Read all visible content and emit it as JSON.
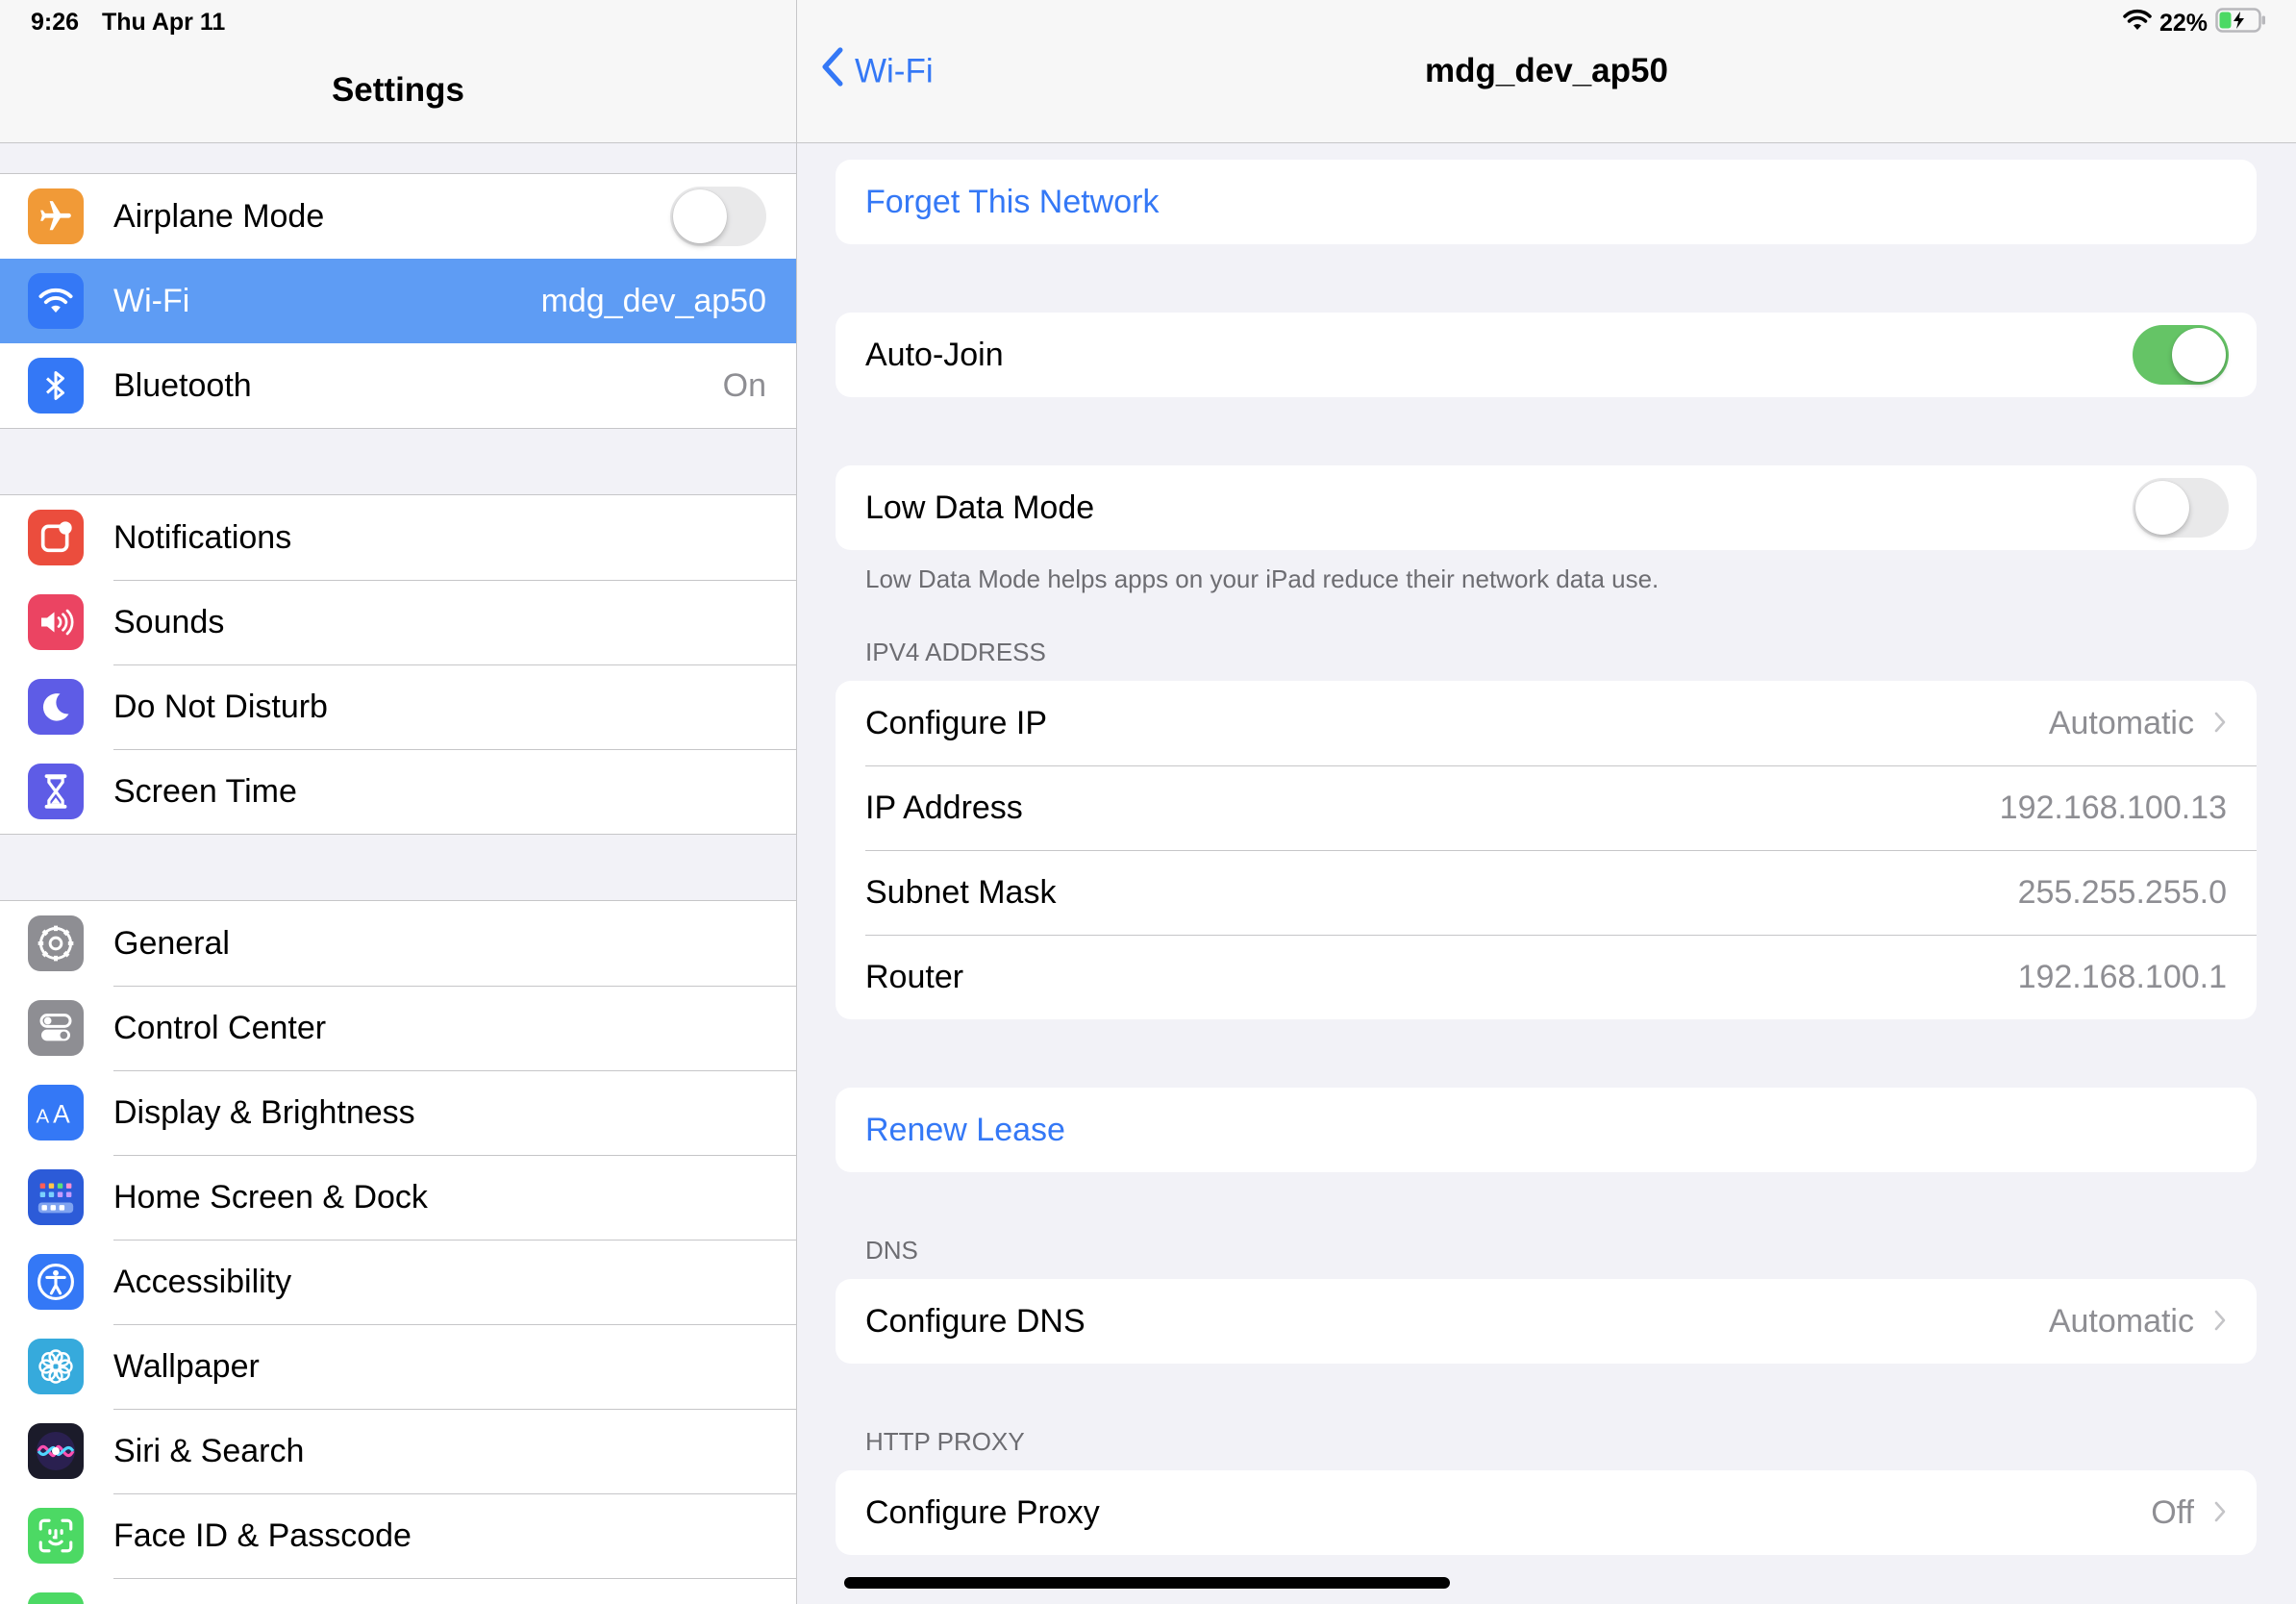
{
  "status_bar": {
    "time": "9:26",
    "date": "Thu Apr 11",
    "battery": "22%"
  },
  "sidebar": {
    "title": "Settings",
    "groups": [
      [
        {
          "label": "Airplane Mode",
          "icon": "airplane-icon",
          "color": "#f19a37",
          "toggle": false
        },
        {
          "label": "Wi-Fi",
          "icon": "wifi-icon",
          "color": "#3478f6",
          "value": "mdg_dev_ap50",
          "selected": true
        },
        {
          "label": "Bluetooth",
          "icon": "bluetooth-icon",
          "color": "#3478f6",
          "value": "On"
        }
      ],
      [
        {
          "label": "Notifications",
          "icon": "notifications-icon",
          "color": "#eb4d3d"
        },
        {
          "label": "Sounds",
          "icon": "speaker-icon",
          "color": "#eb4462"
        },
        {
          "label": "Do Not Disturb",
          "icon": "moon-icon",
          "color": "#5e5ce6"
        },
        {
          "label": "Screen Time",
          "icon": "hourglass-icon",
          "color": "#5e5ce6"
        }
      ],
      [
        {
          "label": "General",
          "icon": "gear-icon",
          "color": "#8e8e93"
        },
        {
          "label": "Control Center",
          "icon": "control-center-icon",
          "color": "#8e8e93"
        },
        {
          "label": "Display & Brightness",
          "icon": "display-aa-icon",
          "color": "#3478f6"
        },
        {
          "label": "Home Screen & Dock",
          "icon": "home-screen-grid-icon",
          "color": "#2c5bd8"
        },
        {
          "label": "Accessibility",
          "icon": "accessibility-icon",
          "color": "#3478f6"
        },
        {
          "label": "Wallpaper",
          "icon": "wallpaper-flower-icon",
          "color": "#36aadc"
        },
        {
          "label": "Siri & Search",
          "icon": "siri-icon",
          "color": "#222222"
        },
        {
          "label": "Face ID & Passcode",
          "icon": "face-id-icon",
          "color": "#4cd964"
        }
      ]
    ]
  },
  "detail": {
    "back_label": "Wi-Fi",
    "title": "mdg_dev_ap50",
    "forget_label": "Forget This Network",
    "auto_join_label": "Auto-Join",
    "auto_join": true,
    "low_data_label": "Low Data Mode",
    "low_data": false,
    "low_data_footnote": "Low Data Mode helps apps on your iPad reduce their network data use.",
    "ipv4_header": "IPV4 ADDRESS",
    "ipv4_rows": [
      {
        "label": "Configure IP",
        "value": "Automatic",
        "chevron": true
      },
      {
        "label": "IP Address",
        "value": "192.168.100.13"
      },
      {
        "label": "Subnet Mask",
        "value": "255.255.255.0"
      },
      {
        "label": "Router",
        "value": "192.168.100.1"
      }
    ],
    "renew_label": "Renew Lease",
    "dns_header": "DNS",
    "dns_label": "Configure DNS",
    "dns_value": "Automatic",
    "proxy_header": "HTTP PROXY",
    "proxy_label": "Configure Proxy",
    "proxy_value": "Off"
  },
  "colors": {
    "accent": "#3478f6",
    "toggle_on": "#65c466",
    "selected_row": "#5e9cf4"
  }
}
